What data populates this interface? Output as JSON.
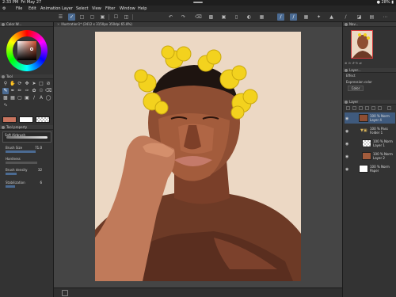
{
  "status": {
    "time": "2:33 PM",
    "date": "Fri May 27",
    "battery": "28%"
  },
  "menu": [
    "File",
    "Edit",
    "Animation",
    "Layer",
    "Select",
    "View",
    "Filter",
    "Window",
    "Help"
  ],
  "left_panel": {
    "color_title": "Color W...",
    "tool_title": "Tool",
    "tool_property_title": "Tool property",
    "brush_name": "Soft Airbrush",
    "brush_size_label": "Brush Size",
    "brush_size_value": "71.0",
    "hardness_label": "Hardness",
    "brush_density_label": "Brush density",
    "brush_density_value": "32",
    "stabilization_label": "Stabilization",
    "stabilization_value": "6"
  },
  "canvas": {
    "tab_title": "Illustration1* (2412 x 3150px 350dpi 65.8%)"
  },
  "right_panel": {
    "navigator_title": "Nav...",
    "effect_title": "Layer...",
    "effect_section": "Effect",
    "expression_color_label": "Expression color",
    "expression_color_value": "Color",
    "layer_title": "Layer",
    "layers": [
      {
        "line1": "100 % Norm",
        "line2": "Layer 4"
      },
      {
        "line1": "100 % Pass",
        "line2": "Folder 1"
      },
      {
        "line1": "100 % Norm",
        "line2": "Layer 1"
      },
      {
        "line1": "100 % Norm",
        "line2": "Layer 2"
      },
      {
        "line1": "100 % Norm",
        "line2": "Paper"
      }
    ]
  },
  "colors": {
    "accent": "#4b6b93",
    "main_color": "#c9755f",
    "sub_color": "#ffffff"
  },
  "icons": [
    "menu-icon",
    "undo-icon",
    "redo-icon",
    "brush-icon",
    "eye-icon",
    "folder-icon"
  ]
}
